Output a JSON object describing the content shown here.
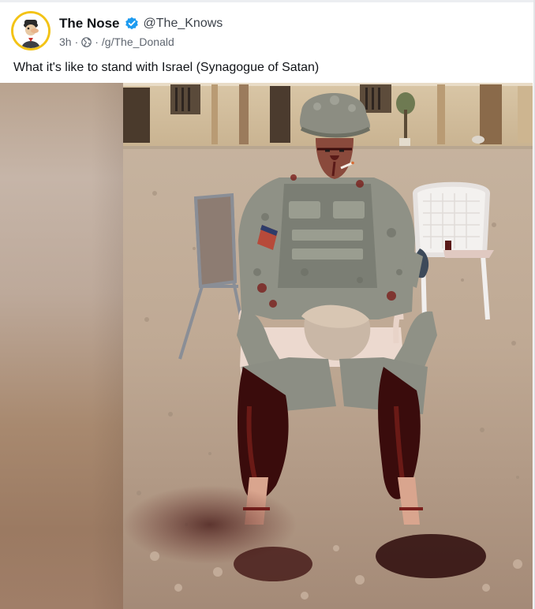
{
  "post": {
    "author": {
      "display_name": "The Nose",
      "handle": "@The_Knows",
      "verified": true
    },
    "meta": {
      "time": "3h",
      "separator": "·",
      "visibility_icon": "globe-icon",
      "group": "/g/The_Donald"
    },
    "text": "What it's like to stand with Israel (Synagogue of Satan)",
    "media": {
      "type": "photo"
    }
  },
  "colors": {
    "avatar_ring": "#f3c316",
    "verified_badge": "#1d9bf0",
    "text_primary": "#111418",
    "text_secondary": "#5f6670"
  }
}
